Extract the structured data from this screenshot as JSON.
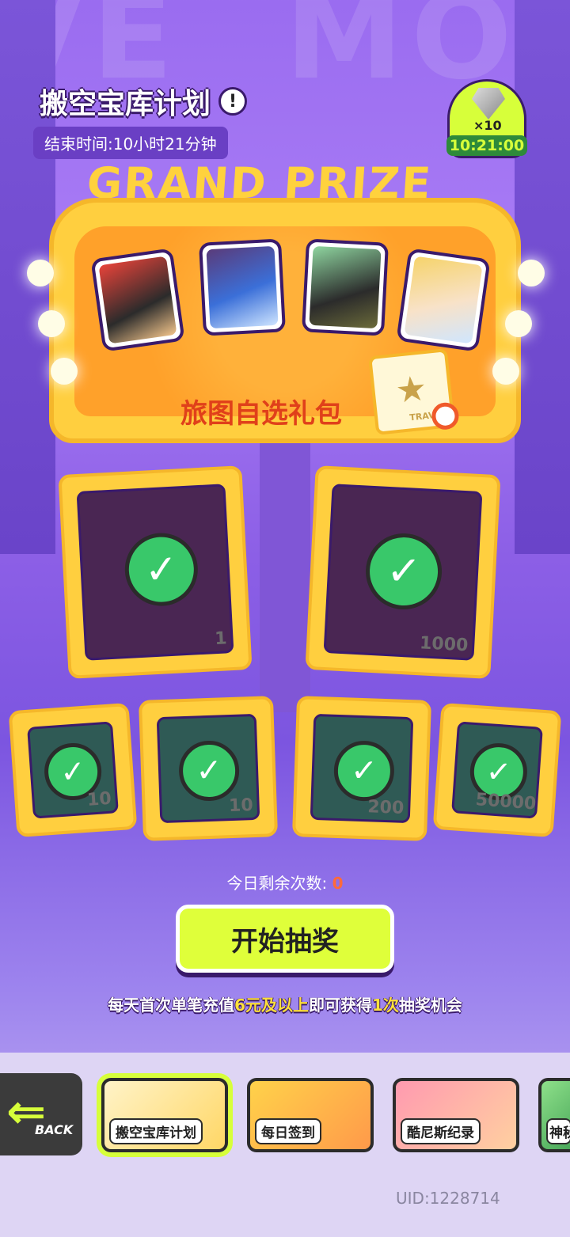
{
  "header": {
    "title": "搬空宝库计划",
    "info_icon": "exclamation-icon",
    "end_time": "结束时间:10小时21分钟"
  },
  "gem_badge": {
    "count": "×10",
    "time": "10:21:00"
  },
  "grand_prize": {
    "title": "GRAND PRIZE",
    "package_label": "旅图自选礼包",
    "package_card_text": "TRAVE"
  },
  "prizes": [
    {
      "qty": "1",
      "claimed": true,
      "color": "#4a2653"
    },
    {
      "qty": "1000",
      "claimed": true,
      "color": "#4a2653"
    },
    {
      "qty": "10",
      "claimed": true,
      "color": "#2f5a55"
    },
    {
      "qty": "10",
      "claimed": true,
      "color": "#2f5a55"
    },
    {
      "qty": "200",
      "claimed": true,
      "color": "#2f5a55"
    },
    {
      "qty": "50000",
      "claimed": true,
      "color": "#2f5a55"
    }
  ],
  "draws": {
    "remaining_label": "今日剩余次数:",
    "remaining_value": "0",
    "start_button": "开始抽奖"
  },
  "note": {
    "p1": "每天首次单笔充值",
    "h1": "6元及以上",
    "p2": "即可获得",
    "h2": "1次",
    "p3": "抽奖机会"
  },
  "nav": {
    "back_label": "BACK",
    "tabs": [
      {
        "label": "搬空宝库计划",
        "selected": true
      },
      {
        "label": "每日签到",
        "selected": false
      },
      {
        "label": "酷尼斯纪录",
        "selected": false
      },
      {
        "label": "神秘",
        "selected": false
      }
    ]
  },
  "uid": "UID:1228714",
  "colors": {
    "accent_lime": "#d7ff3a",
    "board_gold": "#ffcf3f",
    "check_green": "#39c86a",
    "highlight_orange": "#ff6a3a"
  }
}
